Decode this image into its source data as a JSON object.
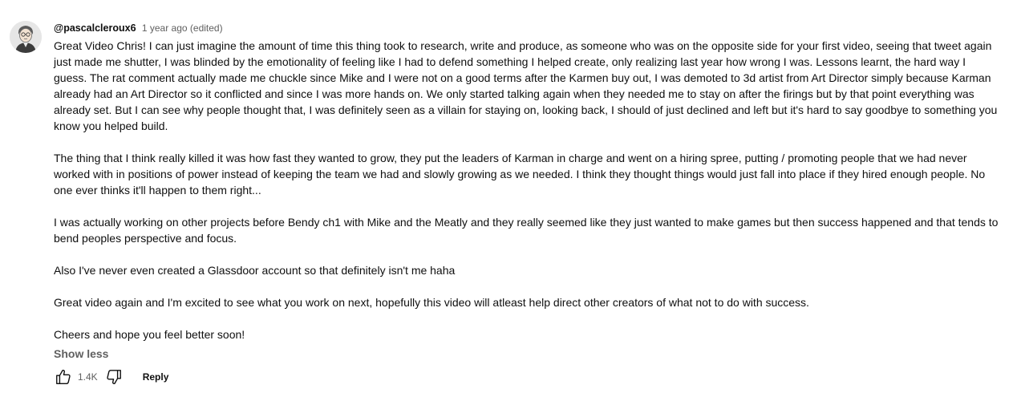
{
  "comment": {
    "author": "@pascalcleroux6",
    "timestamp": "1 year ago (edited)",
    "avatar_icon": "user-avatar",
    "paragraphs": [
      "Great Video Chris! I can just imagine the amount of time this thing took to research, write and produce, as someone who was on the opposite side for your first video, seeing that tweet again just made me shutter, I was blinded by the emotionality of feeling like I had to defend something I helped create, only realizing last year how wrong I was.  Lessons learnt, the hard way I guess.  The rat comment actually made me chuckle since Mike and I were not on a good terms after the Karmen buy out, I was demoted to 3d artist from Art Director simply because Karman already had an Art Director so it conflicted and since I was more hands on.  We only started talking again when they needed me to stay on after the firings but by that point everything was already set.  But I can see why people thought that, I was definitely seen as a villain for staying on, looking back, I should of just declined and left but it's hard to say goodbye to something you know you helped build.",
      "The thing that I think really killed it was how fast they wanted to grow, they put the leaders of Karman in charge and went on a hiring spree, putting / promoting people that we had never worked with in positions of power instead of keeping the team we had and slowly growing as we needed.  I think they  thought things would just fall into place if they hired enough people.  No one ever thinks it'll happen to them right...",
      "I was actually working on other projects before Bendy ch1 with Mike and the Meatly and they really seemed like they just wanted to make games but then success happened and that tends to bend peoples perspective and focus.",
      "Also I've never even created a Glassdoor account so that definitely isn't me haha",
      "Great video again and I'm excited to see what you work on next, hopefully this video will atleast help direct other creators of what not to do with success.",
      "Cheers and hope you feel better soon!"
    ],
    "show_less_label": "Show less",
    "like_count": "1.4K",
    "reply_label": "Reply",
    "icons": {
      "like": "thumbs-up-icon",
      "dislike": "thumbs-down-icon"
    },
    "colors": {
      "text": "#0f0f0f",
      "secondary": "#606060"
    }
  }
}
